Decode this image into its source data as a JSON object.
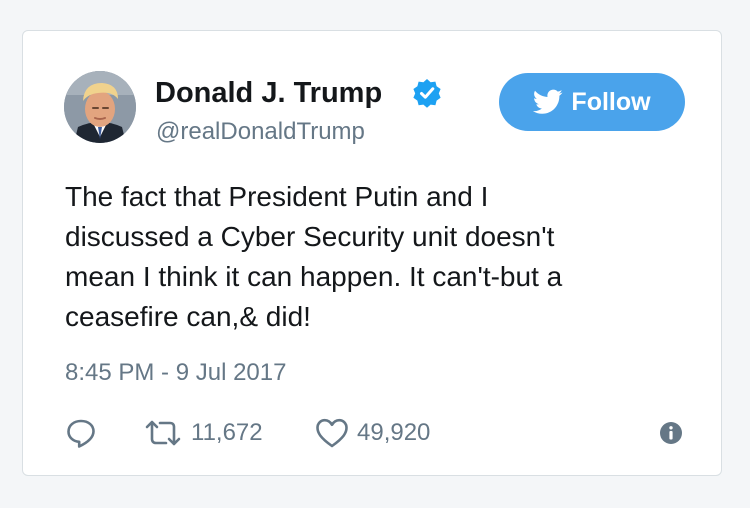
{
  "colors": {
    "accent": "#4aa3eb",
    "text": "#14171a",
    "muted": "#657786",
    "verified": "#1da1f2"
  },
  "user": {
    "display_name": "Donald J. Trump",
    "handle": "@realDonaldTrump",
    "verified_icon": "verified-badge-icon",
    "avatar_icon": "profile-photo"
  },
  "follow_button": {
    "label": "Follow",
    "icon": "bird-icon"
  },
  "tweet": {
    "text": "The fact that President Putin and I\ndiscussed a Cyber Security unit doesn't\nmean I think it can happen. It can't-but a\nceasefire can,& did!",
    "timestamp": "8:45 PM - 9 Jul 2017"
  },
  "actions": {
    "reply_icon": "reply-icon",
    "retweet_icon": "retweet-icon",
    "retweet_count": "11,672",
    "like_icon": "heart-icon",
    "like_count": "49,920",
    "info_icon": "info-icon"
  }
}
